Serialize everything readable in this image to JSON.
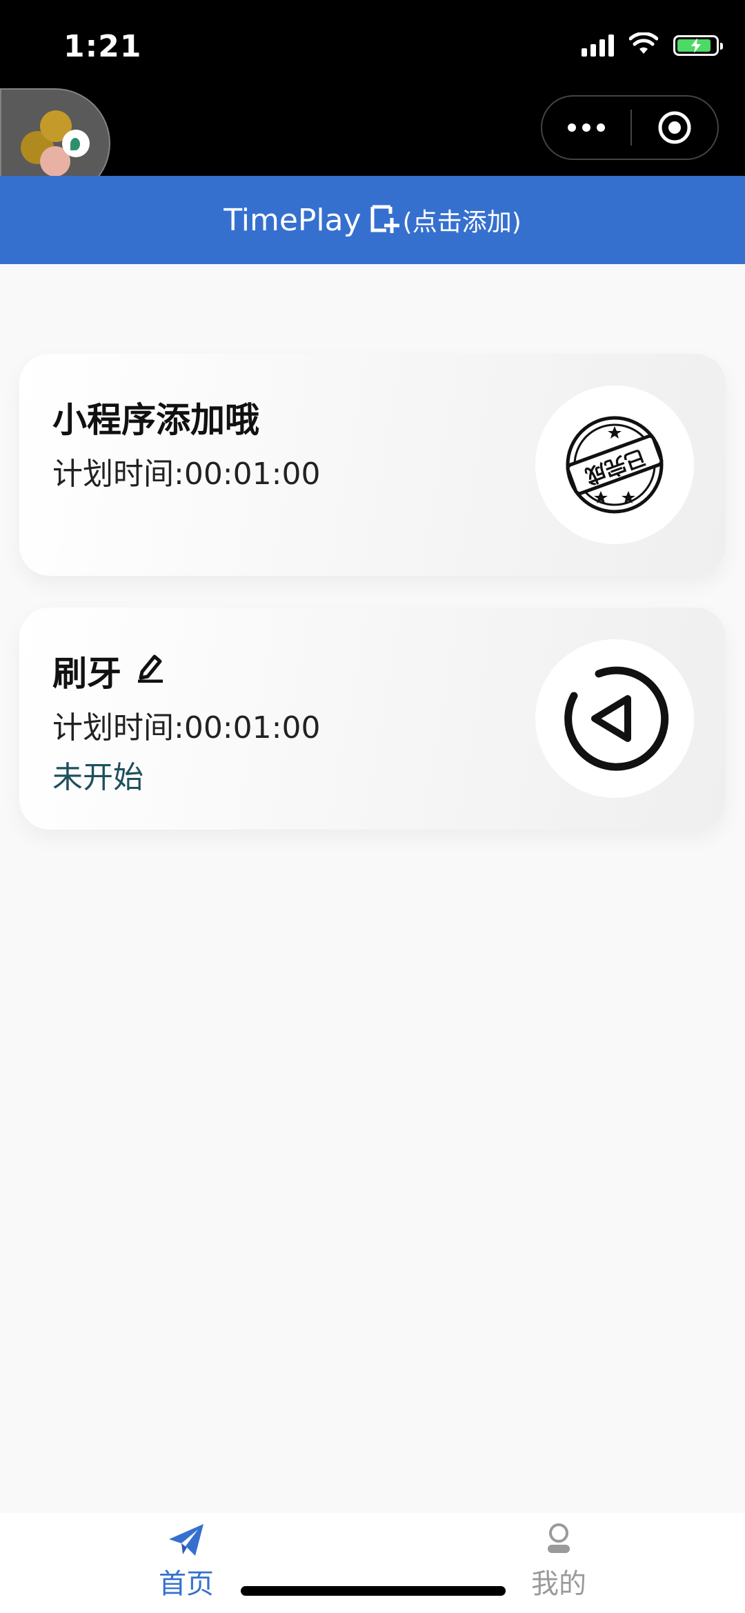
{
  "status_bar": {
    "time": "1:21"
  },
  "header": {
    "app_name": "TimePlay",
    "add_hint": "(点击添加)"
  },
  "tasks": [
    {
      "name": "小程序添加哦",
      "plan_time": "计划时间:00:01:00",
      "status": "",
      "action_icon": "completed-stamp-icon"
    },
    {
      "name": "刷牙",
      "plan_time": "计划时间:00:01:00",
      "status": "未开始",
      "action_icon": "play-icon"
    }
  ],
  "stamp_text": "已完成",
  "tabbar": {
    "tabs": [
      {
        "label": "首页",
        "icon": "paper-plane-icon",
        "active": true
      },
      {
        "label": "我的",
        "icon": "user-icon",
        "active": false
      }
    ]
  },
  "colors": {
    "accent": "#3670cf",
    "status_text": "#1f4f5d",
    "inactive": "#9a9a9a"
  }
}
